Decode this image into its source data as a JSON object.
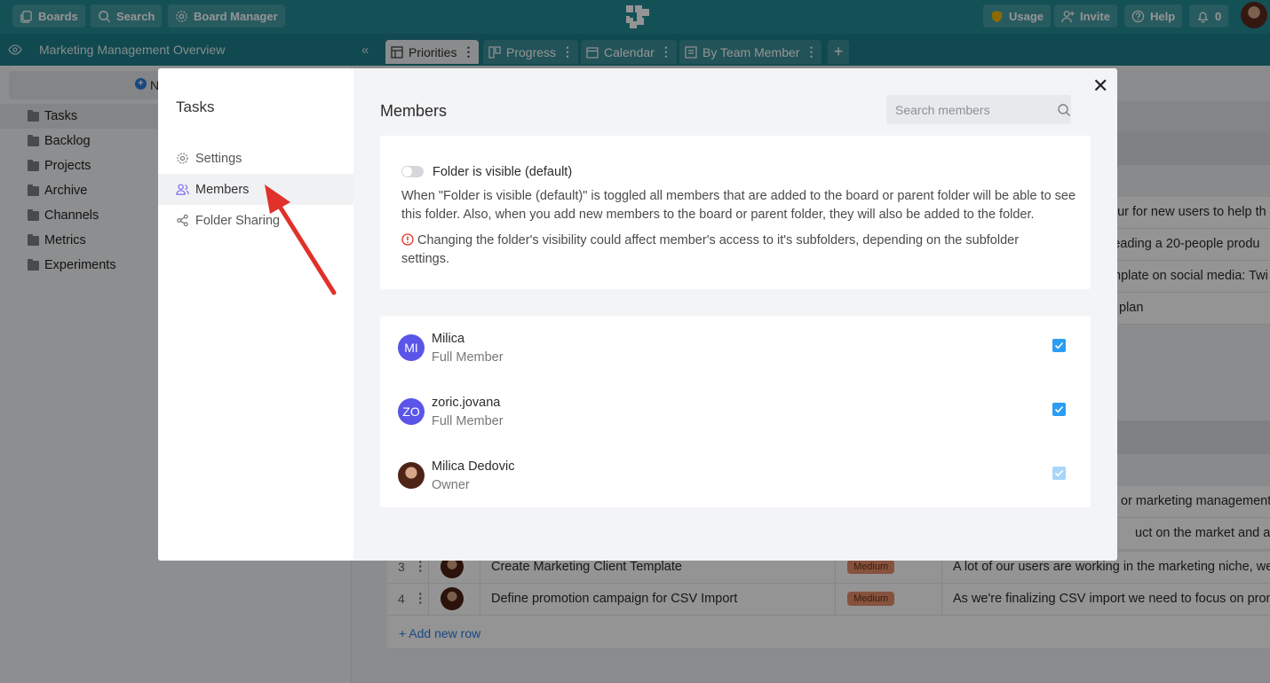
{
  "topbar": {
    "boards_label": "Boards",
    "search_label": "Search",
    "board_manager_label": "Board Manager",
    "usage_label": "Usage",
    "invite_label": "Invite",
    "help_label": "Help",
    "notifications_count": "0"
  },
  "board": {
    "title": "Marketing Management Overview",
    "tabs": [
      {
        "label": "Priorities",
        "active": true
      },
      {
        "label": "Progress"
      },
      {
        "label": "Calendar"
      },
      {
        "label": "By Team Member"
      }
    ]
  },
  "sidebar": {
    "new_label": "N",
    "folders": [
      "Tasks",
      "Backlog",
      "Projects",
      "Archive",
      "Channels",
      "Metrics",
      "Experiments"
    ]
  },
  "background": {
    "text_fragments": [
      "our for new users to help th",
      "leading a 20-people produ",
      "mplate on social media: Twi",
      "plan",
      "or marketing management t",
      "uct on the market and alwa"
    ],
    "rows": [
      {
        "num": "3",
        "task": "Create Marketing Client Template",
        "priority": "Medium",
        "desc": "A lot of our users are working in the marketing niche, we"
      },
      {
        "num": "4",
        "task": "Define promotion campaign for CSV Import",
        "priority": "Medium",
        "desc": "As we're finalizing CSV import we need to focus on pron"
      }
    ],
    "add_row_label": "+ Add new row"
  },
  "modal": {
    "folder_title": "Tasks",
    "nav": [
      "Settings",
      "Members",
      "Folder Sharing"
    ],
    "title": "Members",
    "search_placeholder": "Search members",
    "close_symbol": "✕",
    "visibility": {
      "toggle_label": "Folder is visible (default)",
      "toggle_on": false,
      "description": "When \"Folder is visible (default)\" is toggled all members that are added to the board or parent folder will be able to see this folder. Also, when you add new members to the board or parent folder, they will also be added to the folder.",
      "warning": "Changing the folder's visibility could affect member's access to it's subfolders, depending on the subfolder settings."
    },
    "members": [
      {
        "initials": "MI",
        "name": "Milica",
        "role": "Full Member",
        "checked": true
      },
      {
        "initials": "ZO",
        "name": "zoric.jovana",
        "role": "Full Member",
        "checked": true
      },
      {
        "initials": "",
        "name": "Milica Dedovic",
        "role": "Owner",
        "checked": true,
        "disabled": true
      }
    ]
  },
  "colors": {
    "topbar": "#238c96",
    "accent_blue": "#2a9df4",
    "avatar_purple": "#5a55e8",
    "arrow_red": "#e0312b",
    "usage_shield": "#f2b705"
  }
}
